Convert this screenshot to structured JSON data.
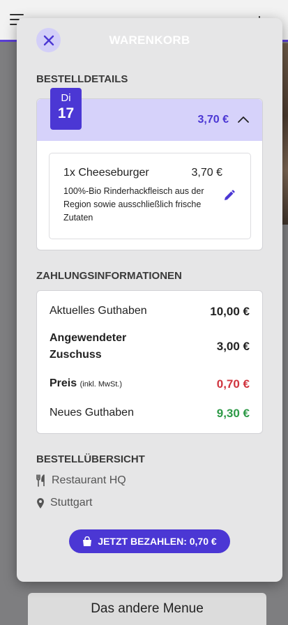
{
  "background": {
    "bottom_button_label": "Das andere Menue"
  },
  "modal": {
    "title": "WARENKORB",
    "close_icon": "close-icon"
  },
  "order_details": {
    "heading": "BESTELLDETAILS",
    "weekday": "Di",
    "day": "17",
    "total": "3,70 €",
    "item": {
      "name": "1x Cheeseburger",
      "price": "3,70 €",
      "description": "100%-Bio Rinderhackfleisch aus der Region sowie ausschließlich frische Zutaten"
    }
  },
  "payment": {
    "heading": "ZAHLUNGSINFORMATIONEN",
    "rows": [
      {
        "label": "Aktuelles Guthaben",
        "value": "10,00 €"
      },
      {
        "label": "Angewendeter Zuschuss",
        "value": "3,00 €"
      },
      {
        "label": "Preis",
        "label_suffix": "(inkl. MwSt.)",
        "value": "0,70 €"
      },
      {
        "label": "Neues Guthaben",
        "value": "9,30 €"
      }
    ]
  },
  "overview": {
    "heading": "BESTELLÜBERSICHT",
    "restaurant": "Restaurant HQ",
    "location": "Stuttgart"
  },
  "pay_button_label": "JETZT BEZAHLEN: 0,70 €",
  "colors": {
    "accent": "#4b37d4",
    "accent_light": "#d6d2fa",
    "negative": "#d0353f",
    "positive": "#2e9a47"
  }
}
